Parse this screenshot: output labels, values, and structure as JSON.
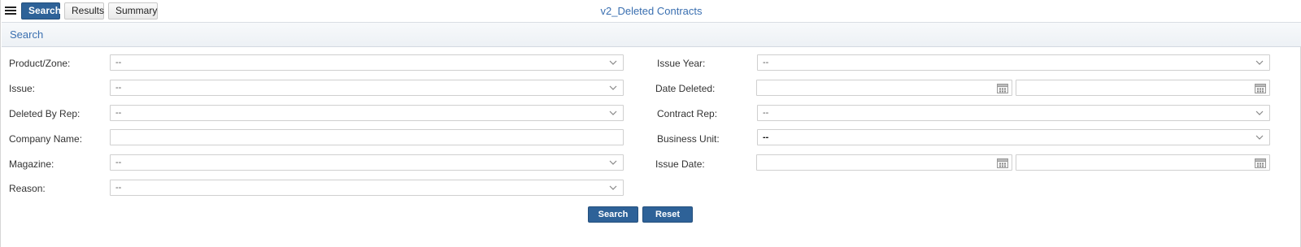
{
  "toolbar": {
    "tabs": [
      {
        "label": "Search"
      },
      {
        "label": "Results"
      },
      {
        "label": "Summary"
      }
    ]
  },
  "page_title": "v2_Deleted Contracts",
  "section": {
    "title": "Search"
  },
  "form": {
    "left": {
      "product_zone": {
        "label": "Product/Zone:",
        "value": "--"
      },
      "issue": {
        "label": "Issue:",
        "value": "--"
      },
      "deleted_by_rep": {
        "label": "Deleted By Rep:",
        "value": "--"
      },
      "company_name": {
        "label": "Company Name:",
        "value": ""
      },
      "magazine": {
        "label": "Magazine:",
        "value": "--"
      },
      "reason": {
        "label": "Reason:",
        "value": "--"
      }
    },
    "right": {
      "issue_year": {
        "label": "Issue Year:",
        "value": "--"
      },
      "date_deleted": {
        "label": "Date Deleted:",
        "from": "",
        "to": ""
      },
      "contract_rep": {
        "label": "Contract Rep:",
        "value": "--"
      },
      "business_unit": {
        "label": "Business Unit:",
        "value": "--"
      },
      "issue_date": {
        "label": "Issue Date:",
        "from": "",
        "to": ""
      }
    }
  },
  "buttons": {
    "search": "Search",
    "reset": "Reset"
  },
  "icons": {
    "menu": "hamburger-menu-icon",
    "dropdown": "chevron-down-icon",
    "calendar": "calendar-icon"
  },
  "colors": {
    "accent": "#2e6298",
    "title": "#3a6fb0"
  }
}
